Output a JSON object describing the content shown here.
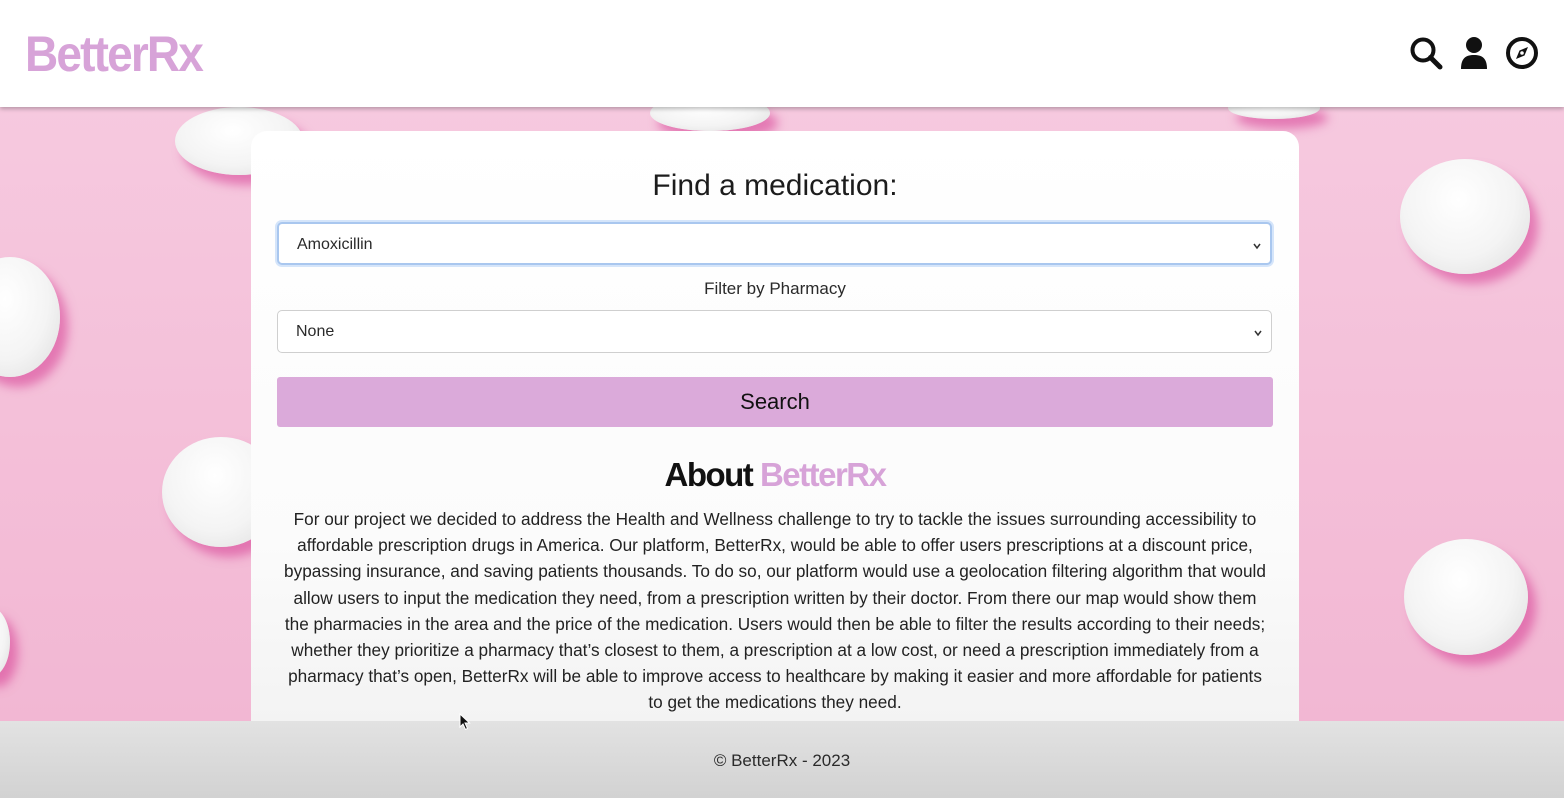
{
  "header": {
    "logo": "BetterRx",
    "icons": [
      "search-icon",
      "user-icon",
      "compass-icon"
    ]
  },
  "search_form": {
    "title": "Find a medication:",
    "medication_select": {
      "selected": "Amoxicillin"
    },
    "pharmacy_filter_label": "Filter by Pharmacy",
    "pharmacy_select": {
      "selected": "None"
    },
    "search_button": "Search"
  },
  "about": {
    "title_prefix": "About",
    "title_brand": "BetterRx",
    "body": "For our project we decided to address the Health and Wellness challenge to try to tackle the issues surrounding accessibility to affordable prescription drugs in America. Our platform, BetterRx, would be able to offer users prescriptions at a discount price, bypassing insurance, and saving patients thousands. To do so, our platform would use a geolocation filtering algorithm that would allow users to input the medication they need, from a prescription written by their doctor. From there our map would show them the pharmacies in the area and the price of the medication. Users would then be able to filter the results according to their needs; whether they prioritize a pharmacy that’s closest to them, a prescription at a low cost, or need a prescription immediately from a pharmacy that’s open, BetterRx will be able to improve access to healthcare by making it easier and more affordable for patients to get the medications they need."
  },
  "footer": {
    "copyright": "© BetterRx - 2023"
  },
  "colors": {
    "brand": "#d7a3d8",
    "button": "#dbaada",
    "background": "#f4c4dc"
  }
}
